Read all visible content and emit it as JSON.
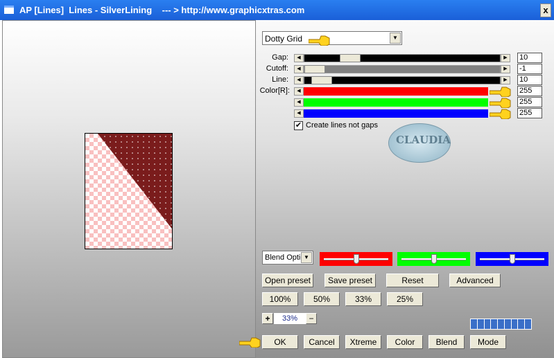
{
  "window": {
    "title": "AP [Lines]  Lines - SilverLining    --- > http://www.graphicxtras.com",
    "close": "x"
  },
  "preset_dropdown": {
    "value": "Dotty Grid"
  },
  "sliders": [
    {
      "label": "Gap:",
      "value": "10",
      "position": 0.2,
      "color": "#000000"
    },
    {
      "label": "Cutoff:",
      "value": "-1",
      "position": 0.0,
      "color": "#808080"
    },
    {
      "label": "Line:",
      "value": "10",
      "position": 0.04,
      "color": "#000000"
    }
  ],
  "color_label": "Color[R]:",
  "color_sliders": [
    {
      "value": "255",
      "color": "#ff0000"
    },
    {
      "value": "255",
      "color": "#00ff00"
    },
    {
      "value": "255",
      "color": "#0000ff"
    }
  ],
  "checkbox": {
    "label": "Create lines not gaps",
    "checked": true
  },
  "logo": {
    "text": "CLAUDIA"
  },
  "blend_dropdown": {
    "value": "Blend Optio"
  },
  "blend_swatches": [
    {
      "color": "#ff0000",
      "position": 0.5
    },
    {
      "color": "#00ff00",
      "position": 0.5
    },
    {
      "color": "#0000ff",
      "position": 0.5
    }
  ],
  "buttons_row1": [
    "Open preset",
    "Save preset",
    "Reset",
    "Advanced"
  ],
  "zoom_buttons": [
    "100%",
    "50%",
    "33%",
    "25%"
  ],
  "zoom": {
    "plus": "+",
    "value": "33%",
    "minus": "−"
  },
  "progress": {
    "segments": 9,
    "color": "#3a6fc8"
  },
  "bottom_buttons": [
    "OK",
    "Cancel",
    "Xtreme",
    "Color",
    "Blend",
    "Mode"
  ],
  "preview": {
    "dark_color": "#7a1c1c",
    "check_color": "#f9c0c0"
  }
}
